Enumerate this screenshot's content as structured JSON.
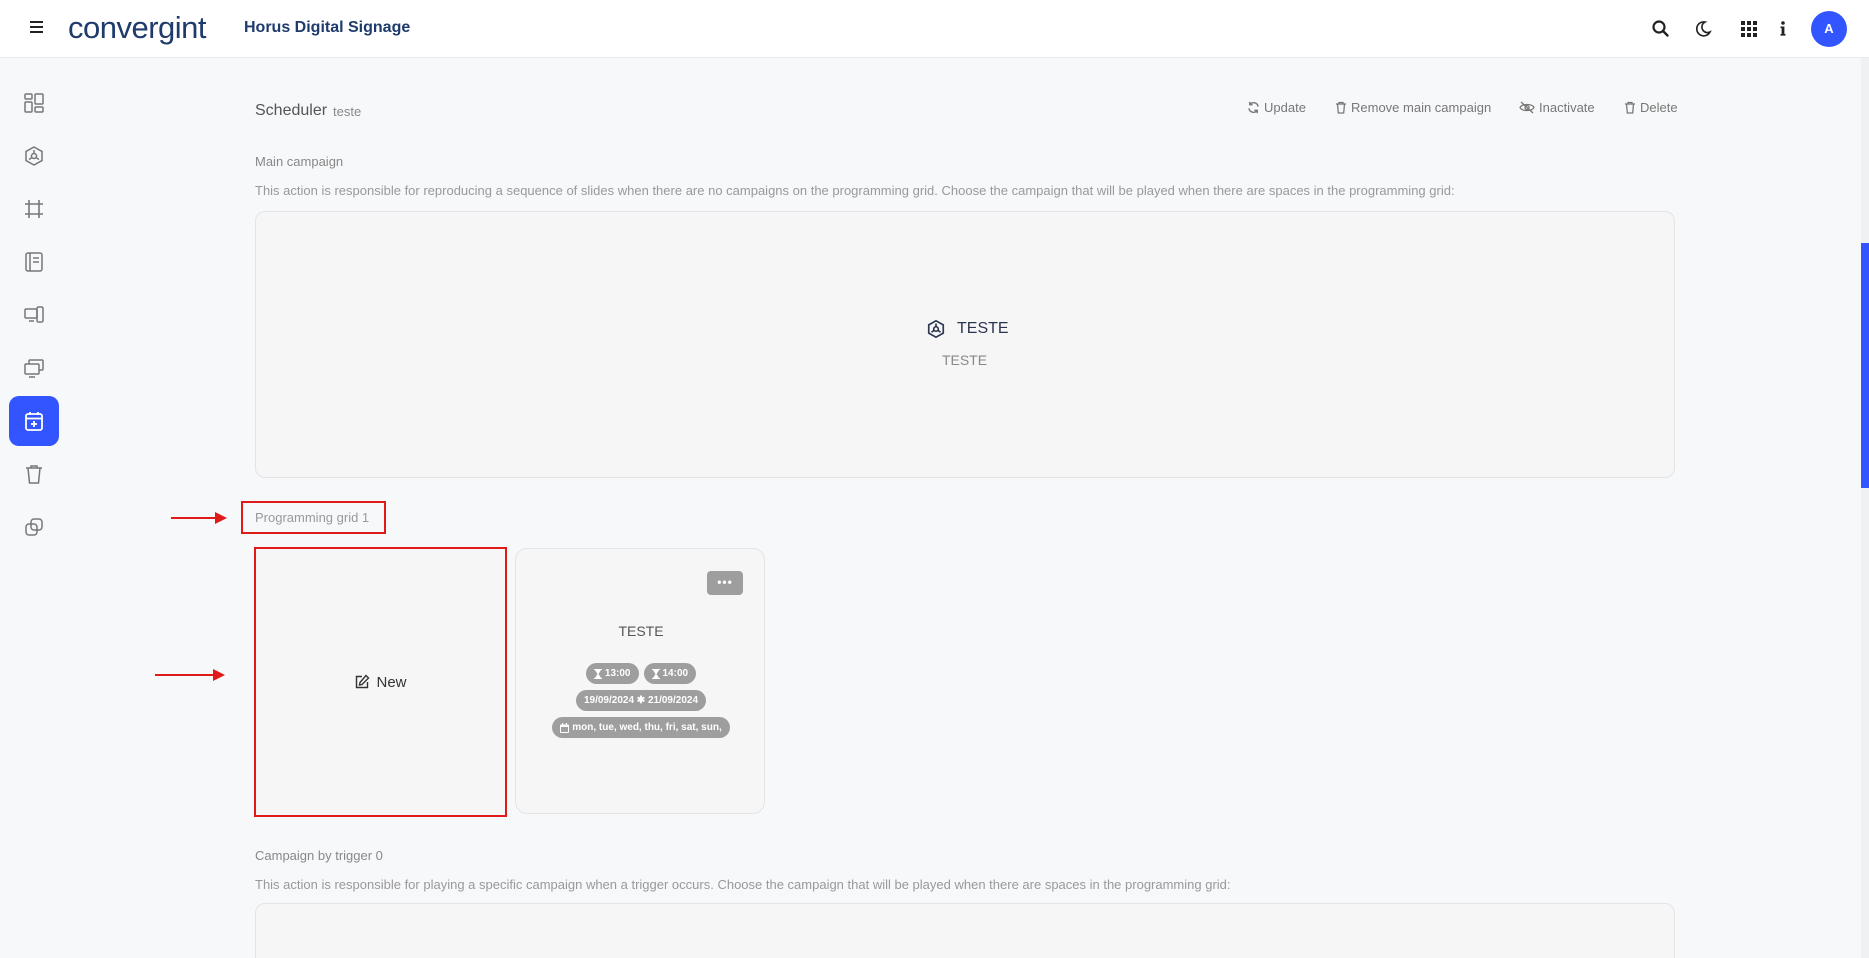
{
  "header": {
    "logo_text": "convergint",
    "app_title": "Horus Digital Signage",
    "avatar_initial": "A"
  },
  "scheduler": {
    "title": "Scheduler",
    "name": "teste",
    "actions": {
      "update": "Update",
      "remove_main": "Remove main campaign",
      "inactivate": "Inactivate",
      "delete": "Delete"
    }
  },
  "main_campaign": {
    "label": "Main campaign",
    "description": "This action is responsible for reproducing a sequence of slides when there are no campaigns on the programming grid. Choose the campaign that will be played when there are spaces in the programming grid:",
    "campaign_name": "TESTE",
    "campaign_sub": "TESTE"
  },
  "programming_grid": {
    "label": "Programming grid 1",
    "new_label": "New",
    "card": {
      "title": "TESTE",
      "menu_dots": "•••",
      "start_time": "13:00",
      "end_time": "14:00",
      "date_range": "19/09/2024 ✱ 21/09/2024",
      "days": "mon, tue, wed, thu, fri, sat, sun,"
    }
  },
  "trigger": {
    "label": "Campaign by trigger 0",
    "description": "This action is responsible for playing a specific campaign when a trigger occurs. Choose the campaign that will be played when there are spaces in the programming grid:"
  },
  "colors": {
    "accent": "#3355ff",
    "highlight": "#e01919",
    "brand": "#1f3b6b"
  }
}
